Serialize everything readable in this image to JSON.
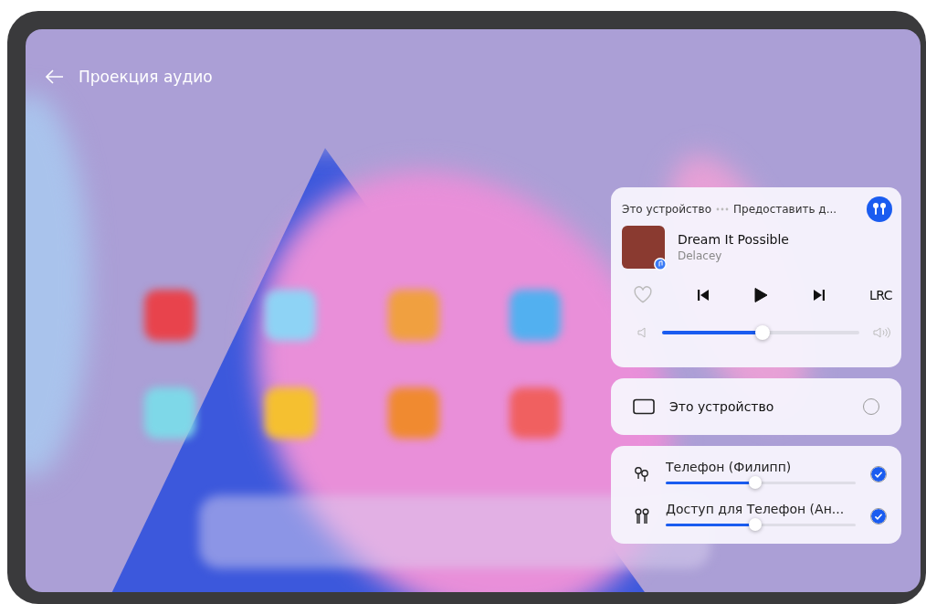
{
  "header": {
    "title": "Проекция аудио"
  },
  "player": {
    "source": "Это устройство",
    "target": "Предоставить д...",
    "track": "Dream It Possible",
    "artist": "Delacey",
    "favorite": false,
    "playing": false,
    "lyrics_label": "LRC",
    "volume": {
      "level": 0.51
    }
  },
  "local_device": {
    "name": "Это устройство",
    "selected": false
  },
  "outputs": [
    {
      "kind": "buds",
      "name": "Телефон (Филипп)",
      "level": 0.47,
      "selected": true
    },
    {
      "kind": "pods",
      "name": "Доступ для Телефон (Ан...",
      "level": 0.47,
      "selected": true
    }
  ]
}
